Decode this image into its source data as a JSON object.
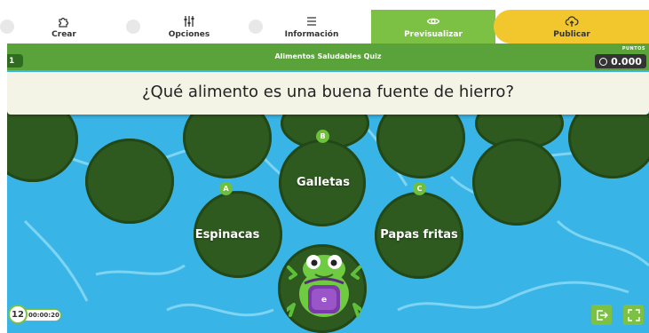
{
  "nav": {
    "create_label": "Crear",
    "options_label": "Opciones",
    "info_label": "Información",
    "preview_label": "Previsualizar",
    "publish_label": "Publicar"
  },
  "game": {
    "quiz_title": "Alimentos Saludables Quiz",
    "level": "1",
    "points_label": "PUNTOS",
    "points": "0.000",
    "question": "¿Qué alimento es una buena fuente de hierro?",
    "timer_count": "12",
    "timer": "00:00:20",
    "answers": [
      {
        "letter": "A",
        "text": "Espinacas"
      },
      {
        "letter": "B",
        "text": "Galletas"
      },
      {
        "letter": "C",
        "text": "Papas fritas"
      }
    ],
    "player_badge": "e"
  },
  "colors": {
    "water": "#39b4e6",
    "pad": "#2e5a20",
    "accent_green": "#7cc143",
    "publish_yellow": "#f2c72d"
  }
}
